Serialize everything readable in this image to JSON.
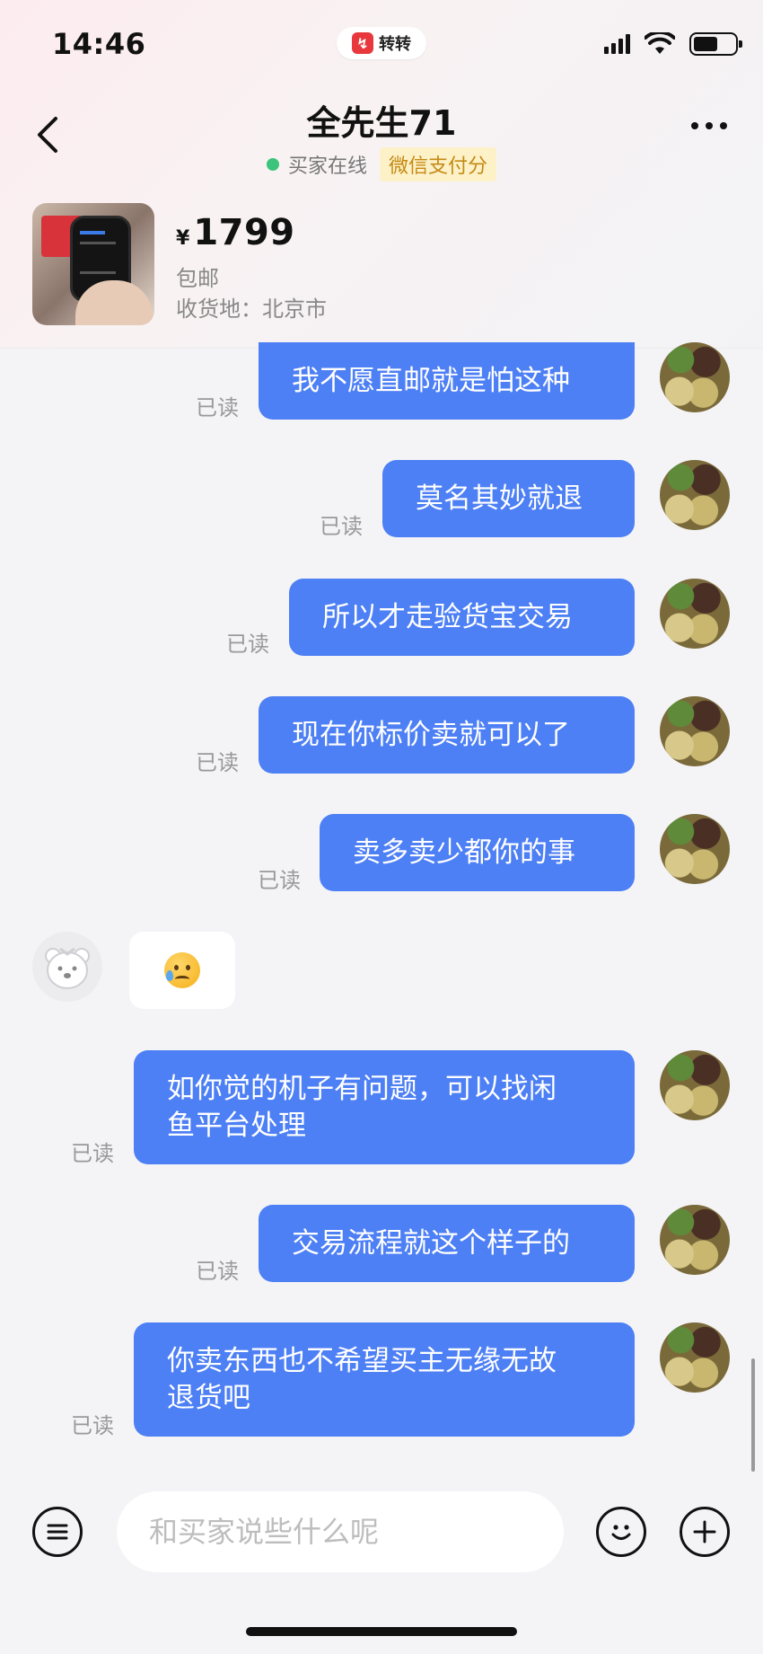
{
  "status_bar": {
    "time": "14:46",
    "app_badge": "转转"
  },
  "header": {
    "title": "全先生71",
    "online_status": "买家在线",
    "pay_badge": "微信支付分"
  },
  "product": {
    "currency": "¥",
    "price": "1799",
    "shipping": "包邮",
    "address": "收货地：北京市"
  },
  "messages": [
    {
      "text": "我不愿直邮就是怕这种",
      "status": "已读"
    },
    {
      "text": "莫名其妙就退",
      "status": "已读"
    },
    {
      "text": "所以才走验货宝交易",
      "status": "已读"
    },
    {
      "text": "现在你标价卖就可以了",
      "status": "已读"
    },
    {
      "text": "卖多卖少都你的事",
      "status": "已读"
    },
    {
      "emoji": "sad-relieved-face"
    },
    {
      "text_line1": "如你觉的机子有问题，可以找闲",
      "text_line2": "鱼平台处理",
      "status": "已读"
    },
    {
      "text": "交易流程就这个样子的",
      "status": "已读"
    },
    {
      "text_line1": "你卖东西也不希望买主无缘无故",
      "text_line2": "退货吧",
      "status": "已读"
    }
  ],
  "input": {
    "placeholder": "和买家说些什么呢"
  },
  "colors": {
    "bubble": "#4d7ff5",
    "online": "#3cc47c",
    "badge_bg": "#fdf1c8",
    "badge_text": "#c58a14"
  }
}
